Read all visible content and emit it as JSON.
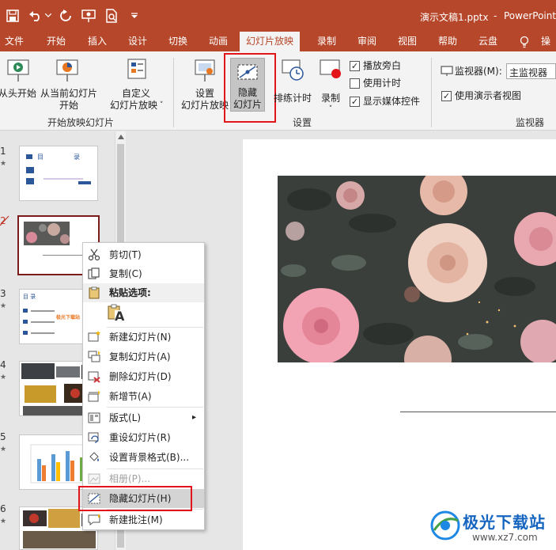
{
  "titlebar": {
    "doc_title": "演示文稿1.pptx",
    "separator": "-",
    "app_name": "PowerPoint"
  },
  "tabs": [
    "文件",
    "开始",
    "插入",
    "设计",
    "切换",
    "动画",
    "幻灯片放映",
    "录制",
    "审阅",
    "视图",
    "帮助",
    "云盘",
    "操作"
  ],
  "active_tab": "幻灯片放映",
  "ribbon": {
    "from_start": "从头开始",
    "from_current_1": "从当前幻灯片",
    "from_current_2": "开始",
    "custom_1": "自定义",
    "custom_2": "幻灯片放映",
    "custom_arrow": "˅",
    "group_start": "开始放映幻灯片",
    "setup_1": "设置",
    "setup_2": "幻灯片放映",
    "hide_1": "隐藏",
    "hide_2": "幻灯片",
    "rehearse": "排练计时",
    "record": "录制",
    "record_arrow": "˅",
    "play_narration": "播放旁白",
    "use_timing": "使用计时",
    "show_media": "显示媒体控件",
    "group_setup": "设置",
    "monitor_label": "监视器(M):",
    "monitor_value": "主监视器",
    "presenter_view": "使用演示者视图",
    "group_monitor": "监视器"
  },
  "thumbnails": {
    "num1": "1",
    "num2": "2",
    "num3": "3",
    "num4": "4",
    "num5": "5",
    "num6": "6",
    "star": "★",
    "t1_a": "目",
    "t1_b": "录",
    "t3_a": "目 录",
    "t3_b": "极光下载站"
  },
  "context_menu": {
    "cut": "剪切(T)",
    "copy": "复制(C)",
    "paste_options": "粘贴选项:",
    "paste_glyph": "A",
    "new_slide": "新建幻灯片(N)",
    "duplicate_slide": "复制幻灯片(A)",
    "delete_slide": "删除幻灯片(D)",
    "add_section": "新增节(A)",
    "layout": "版式(L)",
    "submenu_arrow": "▸",
    "reset_slide": "重设幻灯片(R)",
    "format_bg": "设置背景格式(B)...",
    "photo_album": "相册(P)...",
    "hide_slide": "隐藏幻灯片(H)",
    "new_comment": "新建批注(M)"
  },
  "watermark": {
    "name": "极光下载站",
    "url": "www.xz7.com"
  },
  "colors": {
    "brand": "#b7472a",
    "highlight_box": "#e3151a",
    "ribbon_bg": "#f3f3f3",
    "pane_bg": "#e6e6e6"
  }
}
